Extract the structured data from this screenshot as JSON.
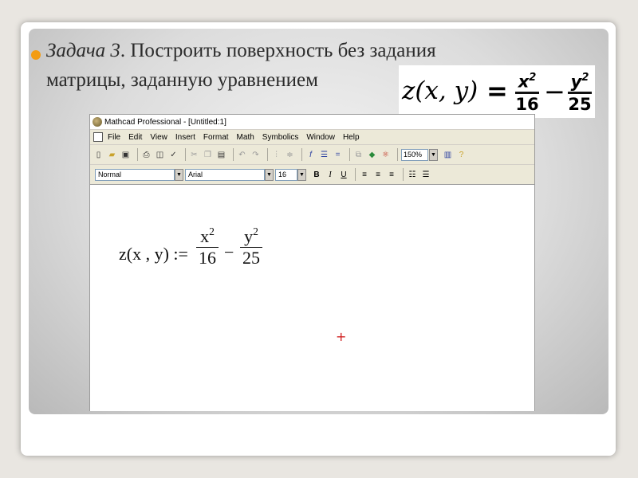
{
  "slide": {
    "task_label": "Задача 3",
    "task_text": ". Построить поверхность без задания",
    "task_text_line2": "матрицы, заданную уравнением"
  },
  "equation_image": {
    "lhs": "z(x, y)",
    "equals": "=",
    "frac1_num": "x",
    "frac1_exp": "2",
    "frac1_den": "16",
    "minus": "−",
    "frac2_num": "y",
    "frac2_exp": "2",
    "frac2_den": "25"
  },
  "window": {
    "title": "Mathcad Professional - [Untitled:1]",
    "menu": [
      "File",
      "Edit",
      "View",
      "Insert",
      "Format",
      "Math",
      "Symbolics",
      "Window",
      "Help"
    ],
    "zoom": "150%",
    "style_select": "Normal",
    "font_select": "Arial",
    "size_select": "16",
    "bold_label": "B",
    "italic_label": "I",
    "underline_label": "U"
  },
  "worksheet": {
    "lhs": "z(x , y) :=",
    "frac1_num": "x",
    "frac1_exp": "2",
    "frac1_den": "16",
    "minus": "−",
    "frac2_num": "y",
    "frac2_exp": "2",
    "frac2_den": "25",
    "cursor": "+"
  },
  "colors": {
    "bullet": "#f39c12",
    "cursor": "#d02020"
  }
}
